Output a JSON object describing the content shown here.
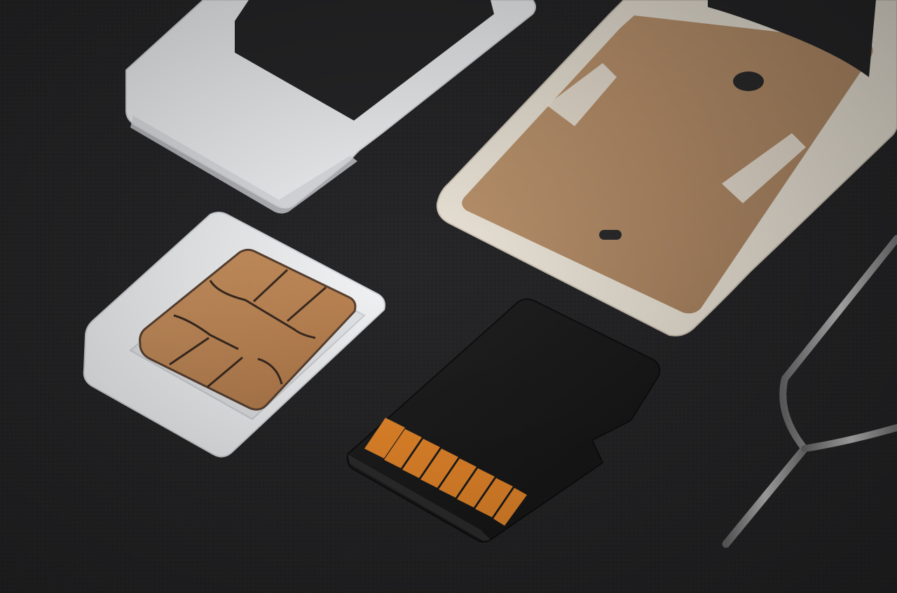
{
  "image": {
    "subject": "sim-and-memory-card-parts",
    "objects": [
      "sim-adapter-frame",
      "nano-sim-card-with-adapter",
      "microsd-card",
      "sim-tray",
      "sim-ejector-pin"
    ]
  },
  "colors": {
    "background": "#262628",
    "plastic_white": "#f3f4f6",
    "chip_gold": "#c4895a",
    "microsd_body": "#1c1c1c",
    "microsd_contacts": "#ef8c2c",
    "tray_frame": "#e8e0d2",
    "tray_backing": "#b38e6a",
    "pin_metal": "#9a9a9a"
  }
}
